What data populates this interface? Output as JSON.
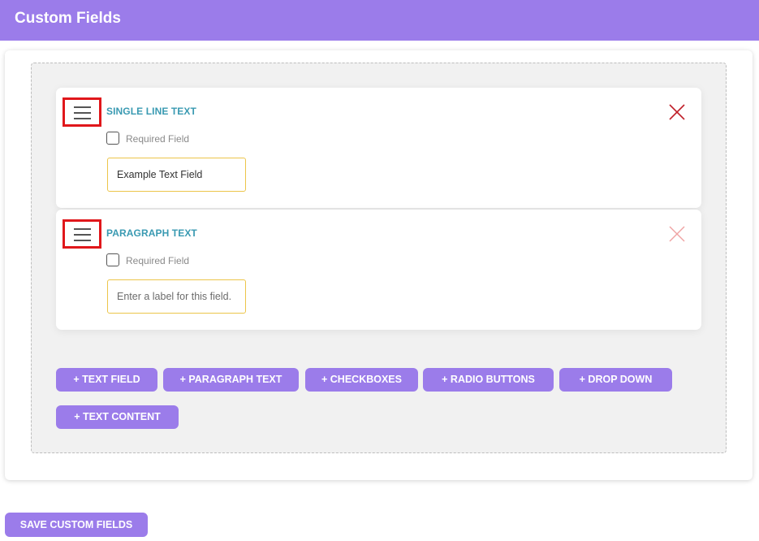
{
  "header": {
    "title": "Custom Fields"
  },
  "fields": [
    {
      "type_label": "SINGLE LINE TEXT",
      "required_label": "Required Field",
      "input_value": "Example Text Field",
      "input_placeholder": "",
      "close_color": "#c0202a"
    },
    {
      "type_label": "PARAGRAPH TEXT",
      "required_label": "Required Field",
      "input_value": "",
      "input_placeholder": "Enter a label for this field.",
      "close_color": "#efa3a3"
    }
  ],
  "add_buttons": [
    "+ TEXT FIELD",
    "+ PARAGRAPH TEXT",
    "+ CHECKBOXES",
    "+ RADIO BUTTONS",
    "+ DROP DOWN",
    "+ TEXT CONTENT"
  ],
  "save_button": "SAVE CUSTOM FIELDS",
  "colors": {
    "accent": "#9b7cea",
    "field_type_text": "#3a9ab2",
    "input_border": "#ecc54a",
    "drag_highlight": "#e0171b"
  },
  "icons": {
    "drag_handle": "hamburger-menu-icon",
    "remove": "close-x-icon"
  }
}
